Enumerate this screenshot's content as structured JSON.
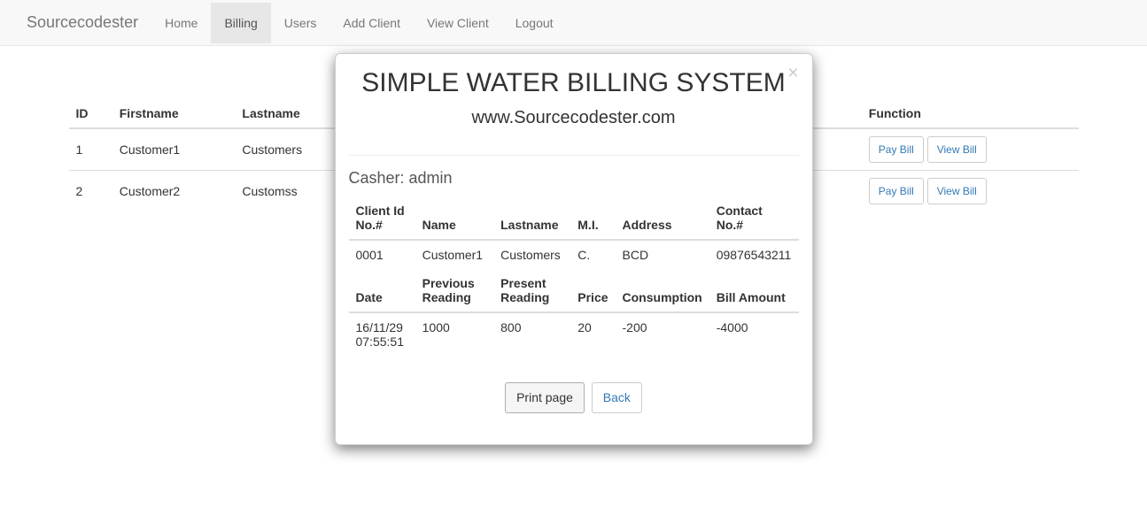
{
  "navbar": {
    "brand": "Sourcecodester",
    "items": [
      {
        "label": "Home"
      },
      {
        "label": "Billing"
      },
      {
        "label": "Users"
      },
      {
        "label": "Add Client"
      },
      {
        "label": "View Client"
      },
      {
        "label": "Logout"
      }
    ]
  },
  "table": {
    "headers": {
      "id": "ID",
      "firstname": "Firstname",
      "lastname": "Lastname",
      "function": "Function"
    },
    "rows": [
      {
        "id": "1",
        "firstname": "Customer1",
        "lastname": "Customers"
      },
      {
        "id": "2",
        "firstname": "Customer2",
        "lastname": "Customss"
      }
    ],
    "actions": {
      "pay": "Pay Bill",
      "view": "View Bill"
    }
  },
  "modal": {
    "title1": "SIMPLE WATER BILLING SYSTEM",
    "title2": "www.Sourcecodester.com",
    "casher_label": "Casher: admin",
    "client_headers": {
      "client_id": "Client Id No.#",
      "name": "Name",
      "lastname": "Lastname",
      "mi": "M.I.",
      "address": "Address",
      "contact": "Contact No.#"
    },
    "client_row": {
      "client_id": "0001",
      "name": "Customer1",
      "lastname": "Customers",
      "mi": "C.",
      "address": "BCD",
      "contact": "09876543211"
    },
    "bill_headers": {
      "date": "Date",
      "previous": "Previous Reading",
      "present": "Present Reading",
      "price": "Price",
      "consumption": "Consumption",
      "amount": "Bill Amount"
    },
    "bill_row": {
      "date": "16/11/29 07:55:51",
      "previous": "1000",
      "present": "800",
      "price": "20",
      "consumption": "-200",
      "amount": "-4000"
    },
    "buttons": {
      "print": "Print page",
      "back": "Back"
    },
    "close": "×"
  }
}
